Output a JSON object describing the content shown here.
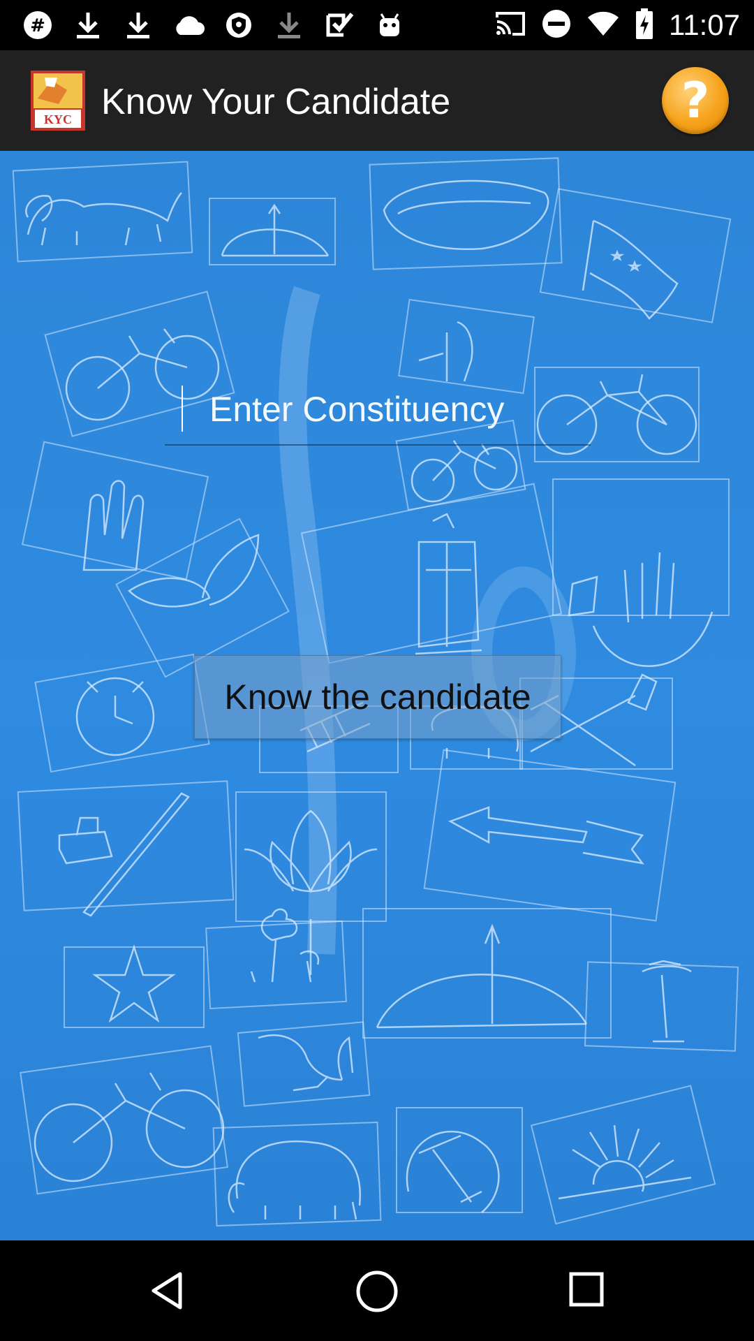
{
  "status_bar": {
    "time": "11:07",
    "left_icons": [
      "hashtag-icon",
      "download-icon",
      "download-icon",
      "cloud-icon",
      "vpn-shield-icon",
      "download-icon",
      "checkbox-icon",
      "android-icon"
    ],
    "right_icons": [
      "cast-icon",
      "do-not-disturb-icon",
      "wifi-icon",
      "battery-charging-icon"
    ]
  },
  "app_bar": {
    "logo_text": "KYC",
    "title": "Know Your Candidate",
    "help_symbol": "?"
  },
  "form": {
    "constituency_placeholder": "Enter Constituency",
    "constituency_value": "",
    "submit_label": "Know the candidate"
  },
  "background_symbols": [
    "lion",
    "bow-and-arrow",
    "conch",
    "flag",
    "bicycle",
    "hand-pump",
    "bicycle",
    "bicycle",
    "hand",
    "leaves",
    "lantern",
    "sickle-and-hand",
    "clock",
    "ladder",
    "elephant",
    "spade-and-stoker",
    "pen-and-inkpot",
    "lotus",
    "arrow",
    "star",
    "flowers",
    "bow-and-arrow",
    "coconut-tree",
    "plough",
    "bicycle",
    "elephant",
    "hammer-and-sickle",
    "rising-sun"
  ],
  "colors": {
    "background": "#2d86d8",
    "app_bar": "#212121",
    "help_button": "#f6a21a",
    "button": "#78a0c8"
  }
}
